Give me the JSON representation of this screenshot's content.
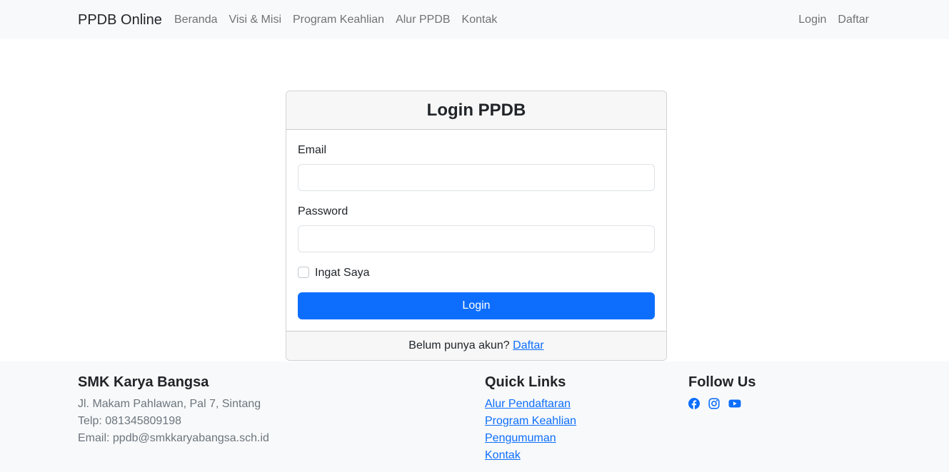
{
  "navbar": {
    "brand": "PPDB Online",
    "links": [
      "Beranda",
      "Visi & Misi",
      "Program Keahlian",
      "Alur PPDB",
      "Kontak"
    ],
    "right_links": [
      "Login",
      "Daftar"
    ]
  },
  "login_card": {
    "title": "Login PPDB",
    "email_label": "Email",
    "email_value": "",
    "password_label": "Password",
    "password_value": "",
    "remember_label": "Ingat Saya",
    "remember_checked": false,
    "submit_label": "Login",
    "footer_text": "Belum punya akun?",
    "footer_link": "Daftar"
  },
  "footer": {
    "school_name": "SMK Karya Bangsa",
    "address": "Jl. Makam Pahlawan, Pal 7, Sintang",
    "phone": "Telp: 081345809198",
    "email": "Email: ppdb@smkkaryabangsa.sch.id",
    "quick_links_title": "Quick Links",
    "quick_links": [
      "Alur Pendaftaran",
      "Program Keahlian",
      "Pengumuman",
      "Kontak"
    ],
    "follow_title": "Follow Us",
    "social_icons": [
      "facebook-icon",
      "instagram-icon",
      "youtube-icon"
    ]
  },
  "colors": {
    "primary": "#0d6efd",
    "navbar_bg": "#f8f9fa",
    "muted_text": "#6c757d"
  }
}
